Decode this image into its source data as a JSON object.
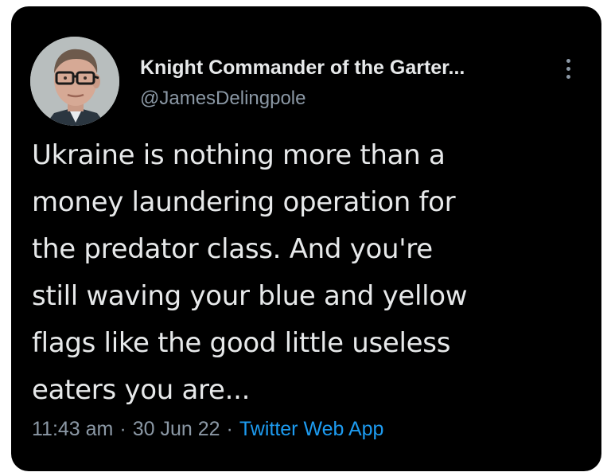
{
  "tweet": {
    "author": {
      "display_name": "Knight Commander of the Garter...",
      "handle": "@JamesDelingpole"
    },
    "text": "Ukraine is nothing more than a\nmoney laundering operation for\nthe predator class. And you're\nstill waving your blue and yellow\nflags like the good little useless\neaters you are...",
    "time": "11:43 am",
    "date": "30 Jun 22",
    "separator": "·",
    "source": "Twitter Web App"
  },
  "icons": {
    "more": "more-vertical-icon",
    "avatar": "profile-photo"
  },
  "colors": {
    "background": "#000000",
    "text": "#e7e9ea",
    "secondary": "#8b98a5",
    "link": "#1d9bf0"
  }
}
